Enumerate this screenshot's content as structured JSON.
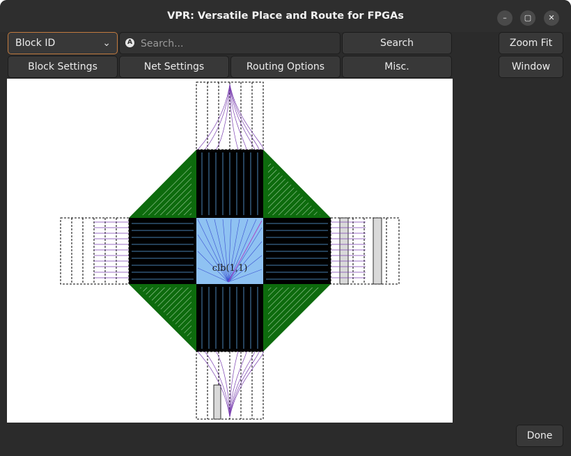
{
  "window": {
    "title": "VPR: Versatile Place and Route for FPGAs"
  },
  "window_controls": {
    "minimize": "–",
    "maximize": "▢",
    "close": "✕"
  },
  "toolbar": {
    "block_select": {
      "value": "Block ID",
      "chevron": "⌄"
    },
    "search": {
      "placeholder": "Search...",
      "icon_glyph": "A"
    },
    "search_button": "Search",
    "zoom_fit_button": "Zoom Fit",
    "window_button": "Window",
    "tabs": [
      "Block Settings",
      "Net Settings",
      "Routing Options",
      "Misc."
    ]
  },
  "canvas": {
    "block_label": "clb(1,1)"
  },
  "footer": {
    "done_button": "Done"
  },
  "colors": {
    "window_bg": "#2b2b2b",
    "button_bg": "#383838",
    "combo_border": "#c27a3e",
    "logic_block": "#8fc2f2",
    "channel": "#000000",
    "switch_box": "#0d6b0d",
    "net_lines": "#7a3fb0"
  }
}
